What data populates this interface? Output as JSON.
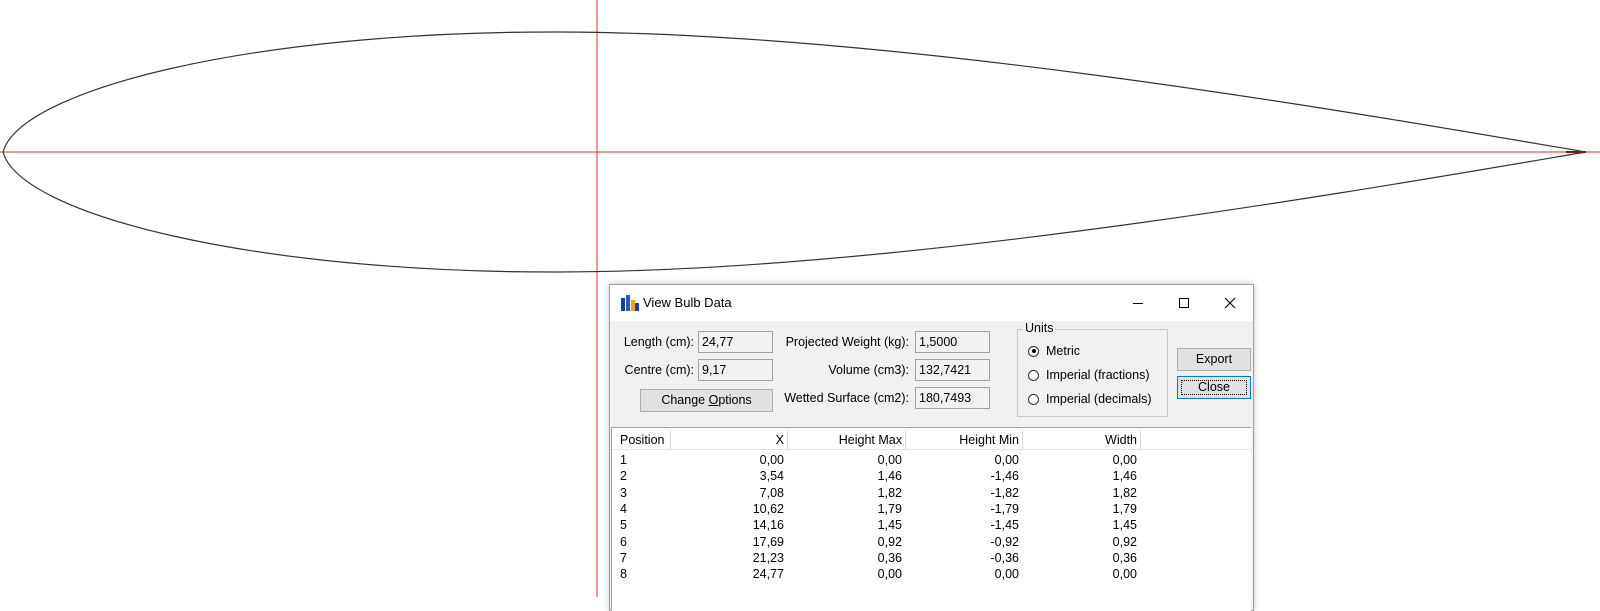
{
  "dialog": {
    "title": "View Bulb Data",
    "length_label": "Length (cm):",
    "length_value": "24,77",
    "centre_label": "Centre (cm):",
    "centre_value": "9,17",
    "change_options_prefix": "Change ",
    "change_options_mnemonic": "O",
    "change_options_suffix": "ptions",
    "weight_label": "Projected Weight (kg):",
    "weight_value": "1,5000",
    "volume_label": "Volume (cm3):",
    "volume_value": "132,7421",
    "surface_label": "Wetted Surface (cm2):",
    "surface_value": "180,7493",
    "units_title": "Units",
    "units_options": [
      "Metric",
      "Imperial (fractions)",
      "Imperial (decimals)"
    ],
    "units_selected": 0,
    "export_label": "Export",
    "close_label": "Close"
  },
  "table": {
    "columns": [
      "Position",
      "X",
      "Height Max",
      "Height Min",
      "Width"
    ],
    "rows": [
      [
        "1",
        "0,00",
        "0,00",
        "0,00",
        "0,00"
      ],
      [
        "2",
        "3,54",
        "1,46",
        "-1,46",
        "1,46"
      ],
      [
        "3",
        "7,08",
        "1,82",
        "-1,82",
        "1,82"
      ],
      [
        "4",
        "10,62",
        "1,79",
        "-1,79",
        "1,79"
      ],
      [
        "5",
        "14,16",
        "1,45",
        "-1,45",
        "1,45"
      ],
      [
        "6",
        "17,69",
        "0,92",
        "-0,92",
        "0,92"
      ],
      [
        "7",
        "21,23",
        "0,36",
        "-0,36",
        "0,36"
      ],
      [
        "8",
        "24,77",
        "0,00",
        "0,00",
        "0,00"
      ]
    ]
  },
  "colors": {
    "axis": "#e03030",
    "profile": "#333333"
  }
}
